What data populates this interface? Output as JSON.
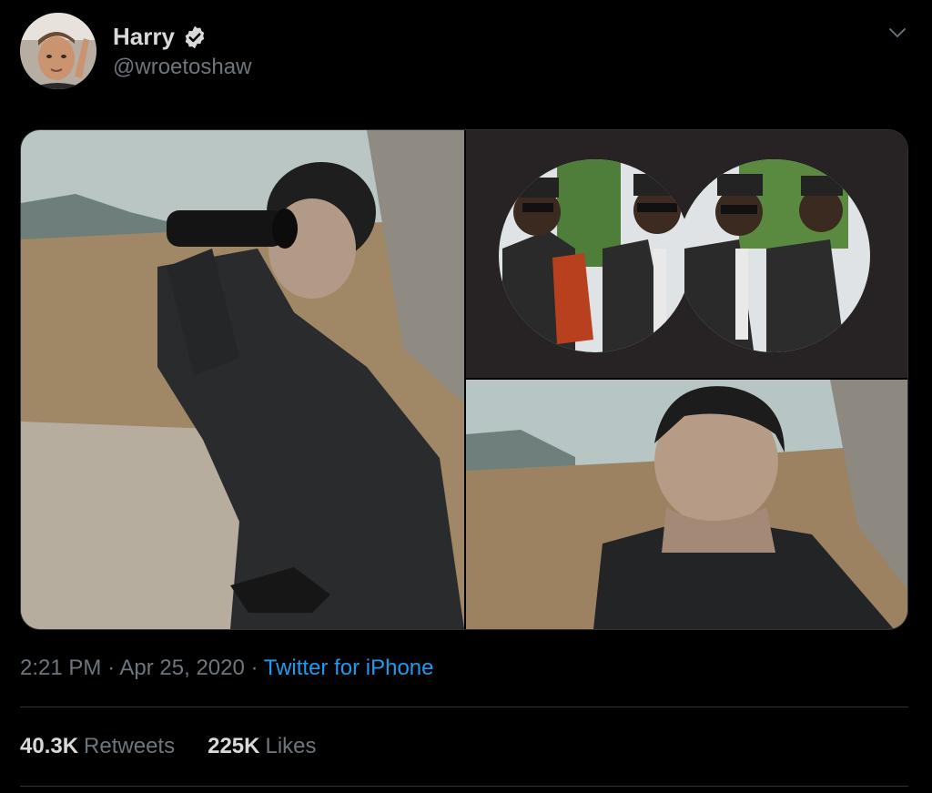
{
  "author": {
    "display_name": "Harry",
    "handle": "@wroetoshaw",
    "verified": true,
    "avatar_icon": "profile-photo"
  },
  "media": {
    "tiles": [
      {
        "icon": "binoculars-photo"
      },
      {
        "icon": "coffin-dance-binocular-view-photo"
      },
      {
        "icon": "man-looking-photo"
      }
    ]
  },
  "meta": {
    "time": "2:21 PM",
    "separator1": "·",
    "date": "Apr 25, 2020",
    "separator2": "·",
    "source": "Twitter for iPhone"
  },
  "stats": {
    "retweets_count": "40.3K",
    "retweets_label": "Retweets",
    "likes_count": "225K",
    "likes_label": "Likes"
  },
  "colors": {
    "background": "#000000",
    "text": "#d9d9d9",
    "muted": "#6e767d",
    "accent": "#1d9bf0",
    "divider": "#2f3336"
  }
}
